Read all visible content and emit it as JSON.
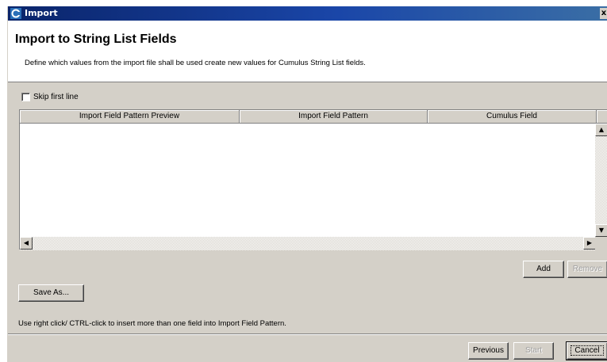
{
  "window": {
    "title": "Import"
  },
  "header": {
    "heading": "Import to String List Fields",
    "description": "Define which values from the import file shall be used create new values for Cumulus String List fields."
  },
  "options": {
    "skip_first_line_label": "Skip first line",
    "skip_first_line_checked": false
  },
  "table": {
    "columns": [
      "Import Field Pattern Preview",
      "Import Field Pattern",
      "Cumulus Field"
    ],
    "rows": []
  },
  "buttons": {
    "add": "Add",
    "remove": "Remove",
    "save_as": "Save As...",
    "previous": "Previous",
    "start": "Start",
    "cancel": "Cancel"
  },
  "hint": "Use right click/ CTRL-click to insert more than one field into Import Field Pattern."
}
